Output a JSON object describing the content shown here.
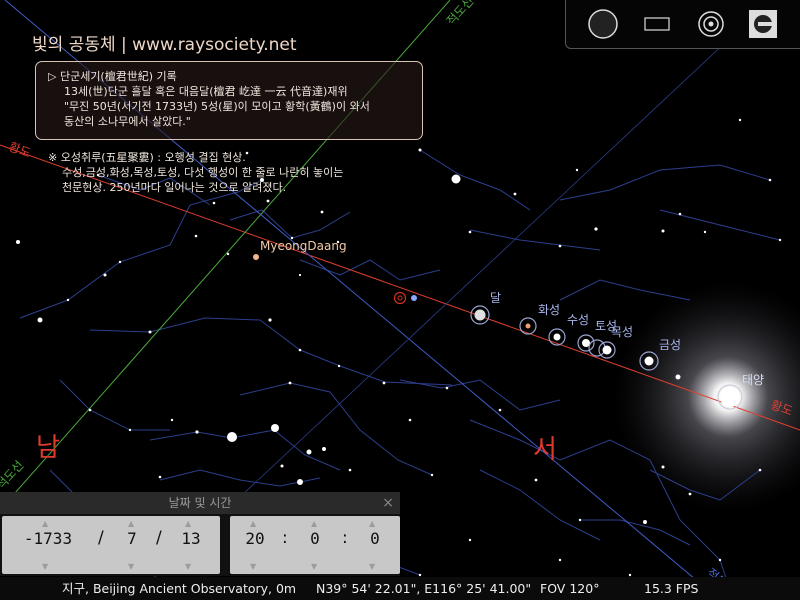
{
  "site_title": "빛의 공동체 | www.raysociety.net",
  "info": {
    "line1": "▷ 단군세기(檀君世紀) 기록",
    "line2": "13세(世)단군 흘달 혹은 대음달(檀君 屹達 一云 代音達)재위",
    "line3": "\"무진 50년(서기전 1733년) 5성(星)이 모이고 황학(黃鶴)이 와서",
    "line4": "동산의 소나무에서 살았다.\""
  },
  "note": {
    "line1": "※ 오성취루(五星聚婁) : 오행성 결집 현상.",
    "line2": "수성,금성,화성,목성,토성, 다섯 행성이 한 줄로 나란히 놓이는",
    "line3": "천문현상. 250년마다 일어나는 것으로 알려졌다."
  },
  "sky_labels": {
    "myeongdaang": "MyeongDaang",
    "moon": "달",
    "mars": "화성",
    "mercury": "수성",
    "saturn": "토성",
    "jupiter": "목성",
    "venus": "금성",
    "sun": "태양",
    "south": "남",
    "west": "서",
    "ecliptic_left": "황도",
    "ecliptic_right": "황도",
    "equator_top": "적도선",
    "equator_left": "적도선",
    "bottom_right": "적도"
  },
  "toolbar": {
    "icons": [
      "ground-toggle-icon",
      "frame-toggle-icon",
      "target-icon",
      "settings-icon"
    ]
  },
  "datetime": {
    "title": "날짜 및 시간",
    "close": "×",
    "year": "-1733",
    "month": "7",
    "day": "13",
    "hour": "20",
    "minute": "0",
    "second": "0",
    "sep_date": "/",
    "sep_time": ":"
  },
  "status": {
    "location": "지구, Beijing Ancient Observatory, 0m",
    "coords": "N39° 54' 22.01\", E116° 25' 41.00\"",
    "fov": "FOV 120°",
    "fps": "15.3 FPS"
  },
  "colors": {
    "ecliptic": "#e04030",
    "equator": "#4aa83a",
    "meridian": "#4a6ad8",
    "constellation": "#2c3f8c",
    "label_red": "#e03a2c",
    "planet_label": "#a8b6ec"
  }
}
